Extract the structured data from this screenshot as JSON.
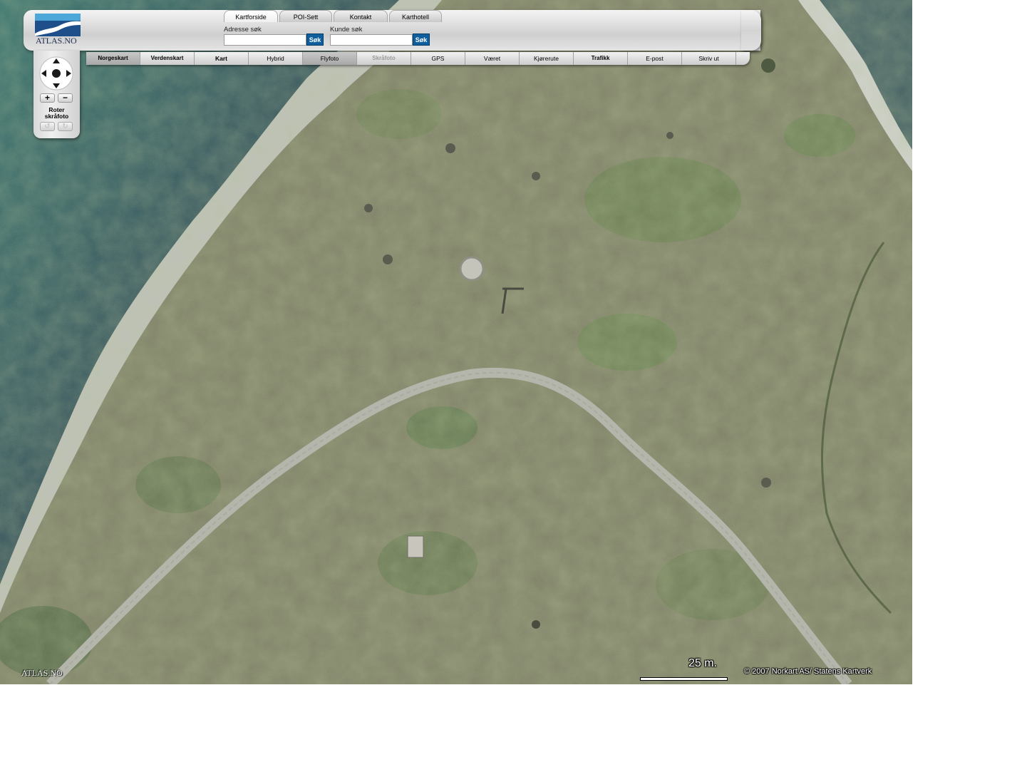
{
  "logo": {
    "text": "ATLAS.NO"
  },
  "tabs": [
    {
      "label": "Kartforside",
      "active": true
    },
    {
      "label": "POI-Sett",
      "active": false
    },
    {
      "label": "Kontakt",
      "active": false
    },
    {
      "label": "Karthotell",
      "active": false
    }
  ],
  "search": {
    "address_label": "Adresse søk",
    "address_value": "",
    "address_button": "Søk",
    "customer_label": "Kunde søk",
    "customer_value": "",
    "customer_button": "Søk"
  },
  "nav": [
    {
      "label": "Norgeskart",
      "state": "selected"
    },
    {
      "label": "Verdenskart",
      "state": "normal"
    },
    {
      "label": "Kart",
      "state": "normal"
    },
    {
      "label": "Hybrid",
      "state": "normal"
    },
    {
      "label": "Flyfoto",
      "state": "selected"
    },
    {
      "label": "Skråfoto",
      "state": "disabled"
    },
    {
      "label": "GPS",
      "state": "normal"
    },
    {
      "label": "Været",
      "state": "normal"
    },
    {
      "label": "Kjørerute",
      "state": "normal"
    },
    {
      "label": "Trafikk",
      "state": "normal"
    },
    {
      "label": "E-post",
      "state": "normal"
    },
    {
      "label": "Skriv ut",
      "state": "normal"
    }
  ],
  "controls": {
    "zoom_in": "+",
    "zoom_out": "−",
    "rotate_label_1": "Roter",
    "rotate_label_2": "skråfoto",
    "rotate_left": "↺",
    "rotate_right": "↻"
  },
  "map": {
    "scale_text": "25 m.",
    "copyright": "© 2007 Norkart AS/ Statens Kartverk",
    "watermark": "ATLAS.NO",
    "colors": {
      "water": "#2f5f63",
      "grass": "#7e8064",
      "road": "#b7b8ae",
      "shore": "#c9ccc8"
    }
  }
}
